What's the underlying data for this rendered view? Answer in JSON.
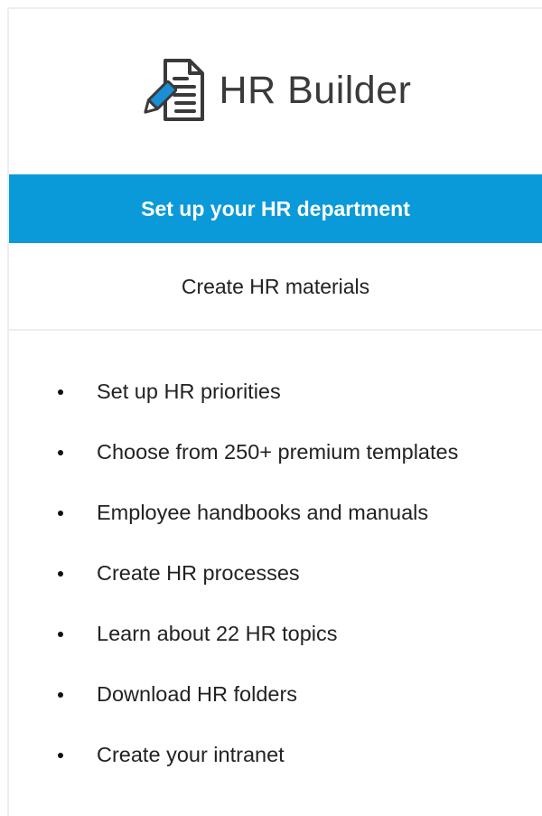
{
  "brand": {
    "name": "HR Builder",
    "icon": "document-pencil-icon",
    "accent": "#1a8fd6"
  },
  "tabs": {
    "primary": {
      "label": "Set up your HR department",
      "color": "#0a9ad9"
    },
    "secondary": {
      "label": "Create HR materials"
    }
  },
  "features": [
    "Set up HR priorities",
    "Choose from 250+ premium templates",
    "Employee handbooks and manuals",
    "Create HR processes",
    "Learn about 22 HR topics",
    "Download HR folders",
    "Create your intranet"
  ]
}
